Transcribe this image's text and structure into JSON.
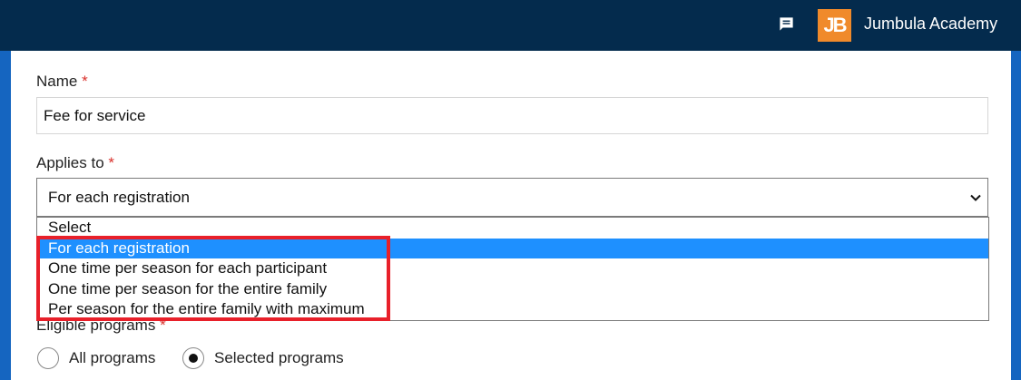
{
  "header": {
    "chat_icon": "chat-icon",
    "logo_text": "JB",
    "org_name": "Jumbula Academy",
    "bg_color": "#042b4d",
    "logo_color": "#f08a2b"
  },
  "form": {
    "required_marker": "*",
    "name": {
      "label": "Name",
      "value": "Fee for service"
    },
    "applies_to": {
      "label": "Applies to",
      "selected": "For each registration",
      "options": [
        "Select",
        "For each registration",
        "One time per season for each participant",
        "One time per season for the entire family",
        "Per season for the entire family with maximum"
      ],
      "highlight_index": 1,
      "highlight_color": "#1e90ff"
    },
    "eligible_programs": {
      "label": "Eligible programs",
      "options": [
        "All programs",
        "Selected programs"
      ],
      "checked": "Selected programs"
    }
  },
  "annotation_color": "#e8202a"
}
